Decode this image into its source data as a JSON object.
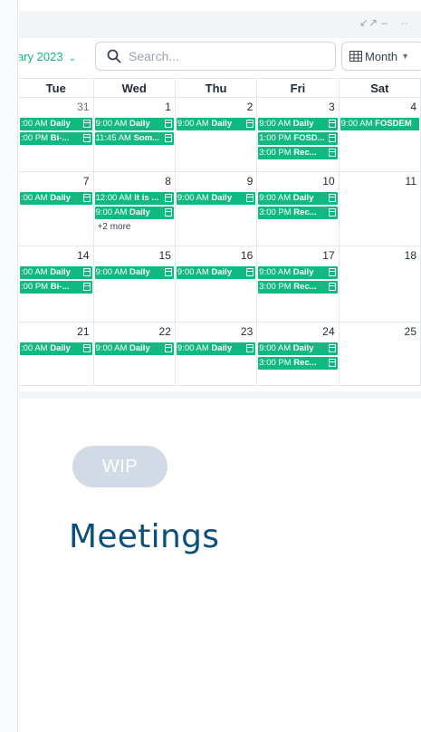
{
  "window": {
    "controls": [
      "↙↗",
      "–",
      "··"
    ]
  },
  "toolbar": {
    "month": "ary 2023",
    "search_placeholder": "Search...",
    "view": "Month"
  },
  "calendar": {
    "days": [
      "Tue",
      "Wed",
      "Thu",
      "Fri",
      "Sat"
    ],
    "weeks": [
      {
        "cells": [
          {
            "num": "31",
            "muted": true,
            "events": [
              [
                "",
                ":00 AM ",
                "Daily"
              ],
              [
                "",
                ":00 PM ",
                "Bi-..."
              ]
            ]
          },
          {
            "num": "1",
            "events": [
              [
                "9:00 AM ",
                "Daily"
              ],
              [
                "11:45 AM ",
                "Som..."
              ]
            ]
          },
          {
            "num": "2",
            "events": [
              [
                "9:00 AM ",
                "Daily"
              ]
            ]
          },
          {
            "num": "3",
            "events": [
              [
                "9:00 AM ",
                "Daily"
              ],
              [
                "1:00 PM ",
                "FOSD..."
              ],
              [
                "3:00 PM ",
                "Rec..."
              ]
            ]
          },
          {
            "num": "4",
            "events": [
              [
                "9:00 AM ",
                "FOSDEM"
              ]
            ]
          }
        ]
      },
      {
        "cells": [
          {
            "num": "7",
            "events": [
              [
                ":00 AM ",
                "Daily"
              ]
            ]
          },
          {
            "num": "8",
            "events": [
              [
                "12:00 AM ",
                "It is ..."
              ],
              [
                "9:00 AM ",
                "Daily"
              ]
            ],
            "more": "+2 more"
          },
          {
            "num": "9",
            "events": [
              [
                "9:00 AM ",
                "Daily"
              ]
            ]
          },
          {
            "num": "10",
            "events": [
              [
                "9:00 AM ",
                "Daily"
              ],
              [
                "3:00 PM ",
                "Rec..."
              ]
            ]
          },
          {
            "num": "11",
            "events": []
          }
        ]
      },
      {
        "cells": [
          {
            "num": "14",
            "events": [
              [
                ":00 AM ",
                "Daily"
              ],
              [
                ":00 PM ",
                "Bi-..."
              ]
            ]
          },
          {
            "num": "15",
            "events": [
              [
                "9:00 AM ",
                "Daily"
              ]
            ]
          },
          {
            "num": "16",
            "events": [
              [
                "9:00 AM ",
                "Daily"
              ]
            ]
          },
          {
            "num": "17",
            "events": [
              [
                "9:00 AM ",
                "Daily"
              ],
              [
                "3:00 PM ",
                "Rec..."
              ]
            ]
          },
          {
            "num": "18",
            "events": []
          }
        ]
      },
      {
        "cells": [
          {
            "num": "21",
            "events": [
              [
                ":00 AM ",
                "Daily"
              ]
            ]
          },
          {
            "num": "22",
            "events": [
              [
                "9:00 AM ",
                "Daily"
              ]
            ]
          },
          {
            "num": "23",
            "events": [
              [
                "9:00 AM ",
                "Daily"
              ]
            ]
          },
          {
            "num": "24",
            "events": [
              [
                "9:00 AM ",
                "Daily"
              ],
              [
                "3:00 PM ",
                "Rec..."
              ]
            ]
          },
          {
            "num": "25",
            "events": []
          }
        ]
      }
    ]
  },
  "badge": "WIP",
  "page_title": "Meetings",
  "colors": {
    "event": "#10b981",
    "accent": "#10b981",
    "title": "#0b4f7c",
    "badge": "#cbd5e1"
  }
}
